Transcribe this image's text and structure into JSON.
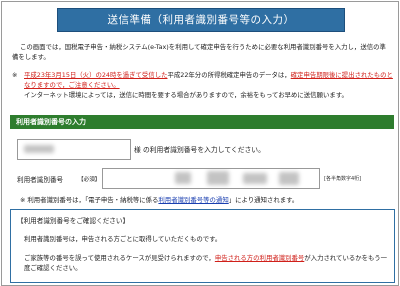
{
  "title_bar": {
    "text": "送信準備（利用者識別番号等の入力）"
  },
  "intro": {
    "text": "この画面では，国税電子申告・納税システム(e-Tax)を利用して確定申告を行うために必要な利用者識別番号を入力し，送信の準備をします。"
  },
  "notice": {
    "mark": "※",
    "red_text": "平成23年3月15日（火）の24時を過ぎて受信した",
    "normal_text": "平成22年分の所得税確定申告のデータは，",
    "red_tail": "確定申告期限後に提出されたものとなりますので，ご注意ください。",
    "second_line": "インターネット環境によっては，送信に時間を要する場合がありますので，余裕をもってお早めに送信願います。"
  },
  "section": {
    "header": "利用者識別番号の入力"
  },
  "name_field": {
    "suffix": "様 の利用者識別番号を入力してください。"
  },
  "id_field": {
    "label": "利用者識別番号",
    "required": "【必須】",
    "hint": "[各半角数字4桁]"
  },
  "note2": {
    "mark": "※",
    "before": "利用者識別番号は，「電子申告・納税等に係る",
    "link": "利用者識別番号等の通知",
    "after": "」により通知されます。"
  },
  "confirm": {
    "title": "【利用者識別番号をご確認ください】",
    "line1": "利用者識別番号は，申告される方ごとに取得していただくものです。",
    "line2_before": "ご家族等の番号を誤って使用されるケースが見受けられますので，",
    "line2_red": "申告される方の利用者識別番号",
    "line2_after": "が入力されているかをもう一度ご確認ください。"
  },
  "colors": {
    "title_bg": "#2f6fa3",
    "section_bg": "#2e7d2e",
    "warning": "#d0201a",
    "link": "#1a3fb0"
  }
}
